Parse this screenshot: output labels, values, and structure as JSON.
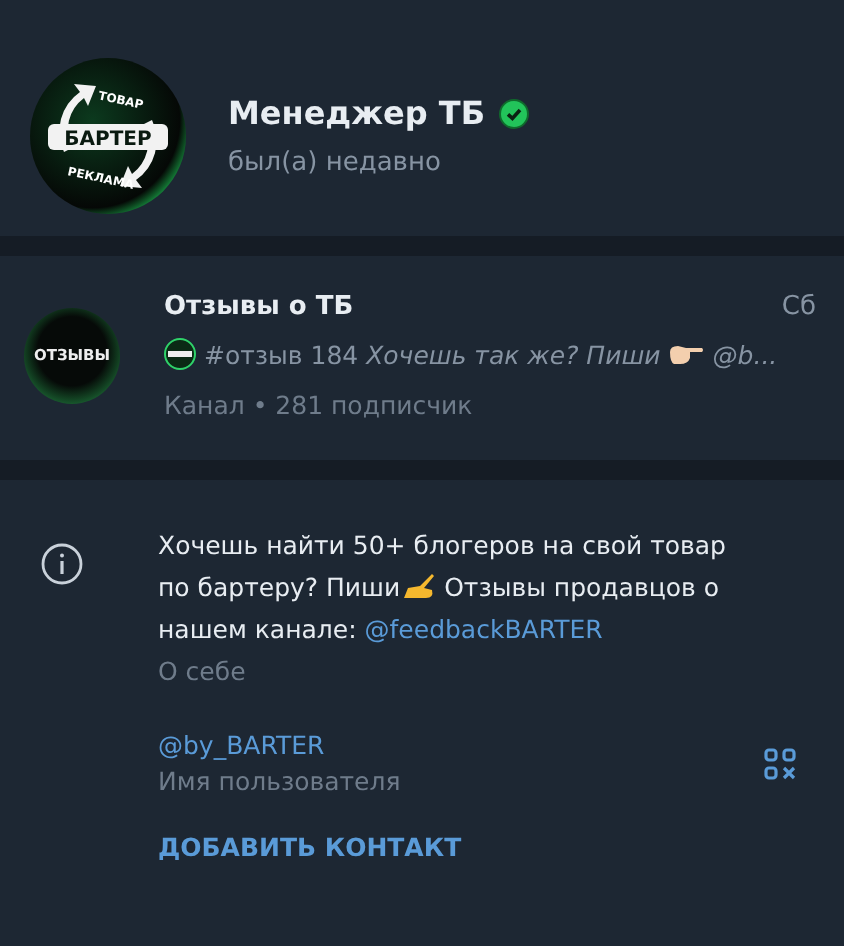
{
  "profile": {
    "name": "Менеджер ТБ",
    "verified": true,
    "status": "был(а) недавно",
    "avatar": {
      "top": "ТОВАР",
      "center": "БАРТЕР",
      "bottom": "РЕКЛАМА"
    }
  },
  "channel": {
    "avatar_text": "ОТЗЫВЫ",
    "title": "Отзывы о ТБ",
    "date": "Сб",
    "preview_before": "#отзыв 184 *Хочешь так же? Пиши*",
    "preview_after": "@b...",
    "meta": "Канал • 281 подписчик"
  },
  "about": {
    "text_before": "Хочешь найти 50+ блогеров на свой товар по бартеру? Пиши",
    "text_after": " Отзывы продавцов о нашем канале: ",
    "link": "@feedbackBARTER",
    "label": "О себе"
  },
  "username": {
    "value": "@by_BARTER",
    "label": "Имя пользователя"
  },
  "action": "ДОБАВИТЬ КОНТАКТ"
}
